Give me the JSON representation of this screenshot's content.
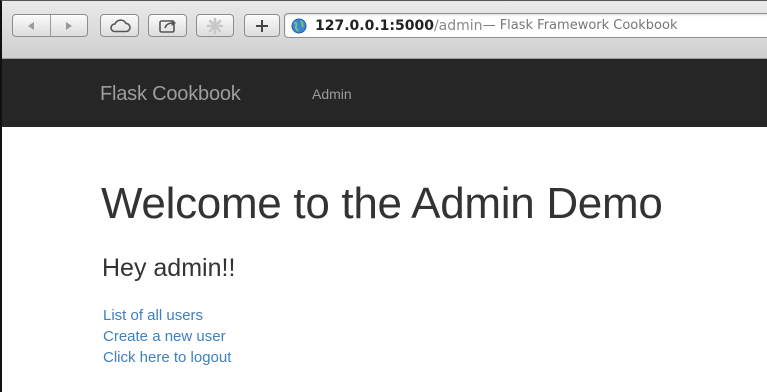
{
  "browser": {
    "url_host": "127.0.0.1:5000",
    "url_path": "/admin",
    "url_title": " — Flask Framework Cookbook",
    "icons": [
      "back-icon",
      "forward-icon",
      "icloud-icon",
      "share-icon",
      "reader-icon",
      "add-tab-icon",
      "globe-icon"
    ]
  },
  "navbar": {
    "brand": "Flask Cookbook",
    "items": [
      {
        "label": "Admin"
      }
    ]
  },
  "main": {
    "heading": "Welcome to the Admin Demo",
    "greeting": "Hey admin!!",
    "links": [
      {
        "label": "List of all users"
      },
      {
        "label": "Create a new user"
      },
      {
        "label": "Click here to logout"
      }
    ]
  },
  "colors": {
    "navbar_bg": "#262626",
    "navbar_text": "#9d9d9d",
    "heading_text": "#333333",
    "link": "#3e80c0"
  }
}
